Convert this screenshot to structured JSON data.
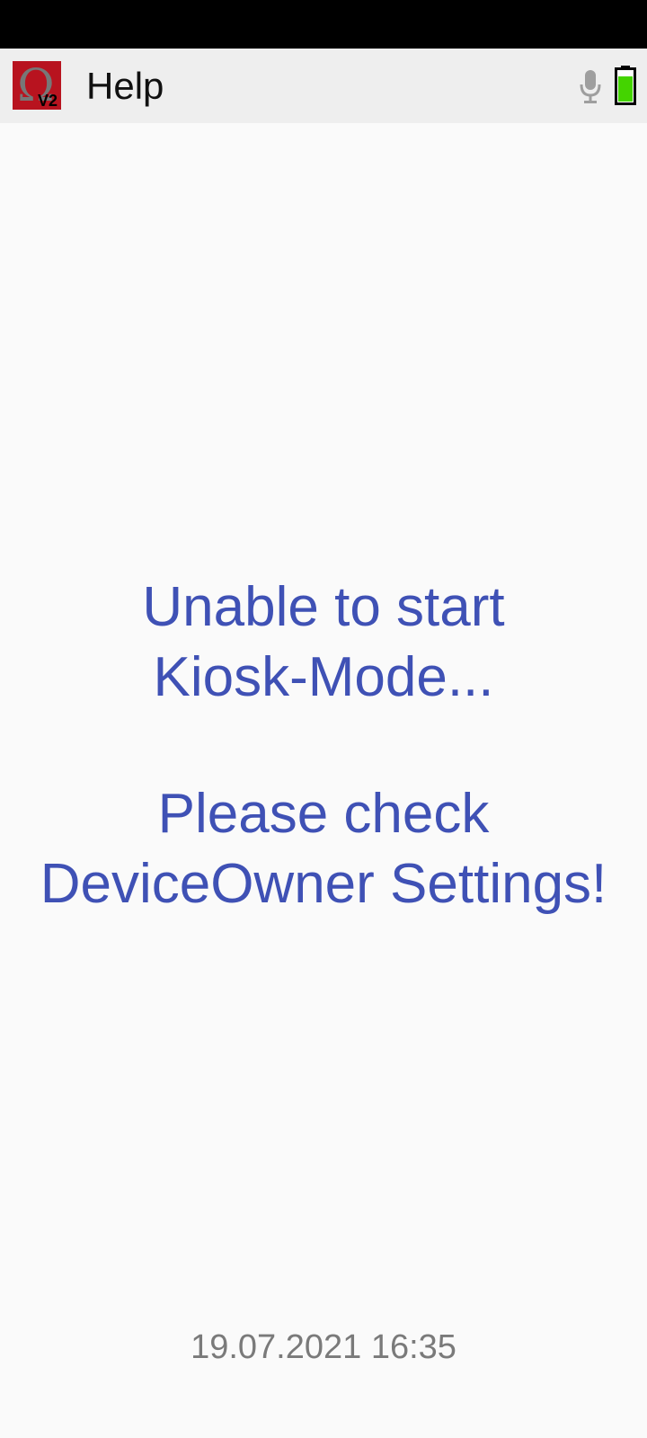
{
  "app_bar": {
    "title": "Help",
    "logo_icon": "omega-v2-logo",
    "logo_badge": "V2",
    "mic_icon": "microphone-icon",
    "battery_icon": "battery-icon",
    "battery_color": "#44d400"
  },
  "message": {
    "line1": "Unable to start",
    "line2": "Kiosk-Mode...",
    "line3": "Please check",
    "line4": "DeviceOwner Settings!",
    "color": "#3f51b5"
  },
  "footer": {
    "timestamp": "19.07.2021 16:35"
  }
}
